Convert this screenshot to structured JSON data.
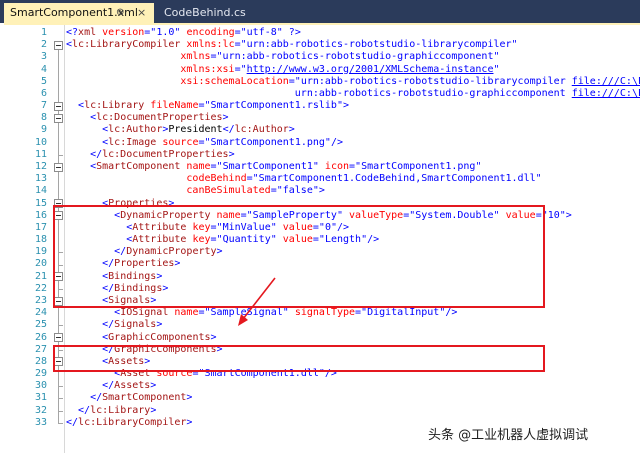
{
  "tabs": [
    {
      "label": "SmartComponent1.xml",
      "pin_icon": "pin-icon",
      "pin_glyph": "⊕",
      "close_icon": "close-icon",
      "close_glyph": "×",
      "active": true
    },
    {
      "label": "CodeBehind.cs",
      "active": false
    }
  ],
  "code_lines": [
    {
      "n": "1",
      "t": [
        [
          "b",
          "<?"
        ],
        [
          "e",
          "xml"
        ],
        [
          "a",
          " version"
        ],
        [
          "b",
          "=\""
        ],
        [
          "v",
          "1.0"
        ],
        [
          "b",
          "\""
        ],
        [
          "a",
          " encoding"
        ],
        [
          "b",
          "=\""
        ],
        [
          "v",
          "utf-8"
        ],
        [
          "b",
          "\" ?>"
        ]
      ]
    },
    {
      "n": "2",
      "t": [
        [
          "b",
          "<"
        ],
        [
          "e",
          "lc:LibraryCompiler"
        ],
        [
          "a",
          " xmlns:lc"
        ],
        [
          "b",
          "=\""
        ],
        [
          "v",
          "urn:abb-robotics-robotstudio-librarycompiler"
        ],
        [
          "b",
          "\""
        ]
      ]
    },
    {
      "n": "3",
      "t": [
        [
          "a",
          "                   xmlns"
        ],
        [
          "b",
          "=\""
        ],
        [
          "v",
          "urn:abb-robotics-robotstudio-graphiccomponent"
        ],
        [
          "b",
          "\""
        ]
      ]
    },
    {
      "n": "4",
      "t": [
        [
          "a",
          "                   xmlns:xsi"
        ],
        [
          "b",
          "=\""
        ],
        [
          "u",
          "http://www.w3.org/2001/XMLSchema-instance"
        ],
        [
          "b",
          "\""
        ]
      ]
    },
    {
      "n": "5",
      "t": [
        [
          "a",
          "                   xsi:schemaLocation"
        ],
        [
          "b",
          "=\""
        ],
        [
          "v",
          "urn:abb-robotics-robotstudio-librarycompiler "
        ],
        [
          "u",
          "file:///C:\\Progra"
        ]
      ]
    },
    {
      "n": "6",
      "t": [
        [
          "v",
          "                                      urn:abb-robotics-robotstudio-graphiccomponent "
        ],
        [
          "u",
          "file:///C:\\Progra"
        ]
      ]
    },
    {
      "n": "7",
      "t": [
        [
          "b",
          "  <"
        ],
        [
          "e",
          "lc:Library"
        ],
        [
          "a",
          " fileName"
        ],
        [
          "b",
          "=\""
        ],
        [
          "v",
          "SmartComponent1.rslib"
        ],
        [
          "b",
          "\">"
        ]
      ]
    },
    {
      "n": "8",
      "t": [
        [
          "b",
          "    <"
        ],
        [
          "e",
          "lc:DocumentProperties"
        ],
        [
          "b",
          ">"
        ]
      ]
    },
    {
      "n": "9",
      "t": [
        [
          "b",
          "      <"
        ],
        [
          "e",
          "lc:Author"
        ],
        [
          "b",
          ">"
        ],
        [
          "",
          "President"
        ],
        [
          "b",
          "</"
        ],
        [
          "e",
          "lc:Author"
        ],
        [
          "b",
          ">"
        ]
      ]
    },
    {
      "n": "10",
      "t": [
        [
          "b",
          "      <"
        ],
        [
          "e",
          "lc:Image"
        ],
        [
          "a",
          " source"
        ],
        [
          "b",
          "=\""
        ],
        [
          "v",
          "SmartComponent1.png"
        ],
        [
          "b",
          "\"/>"
        ]
      ]
    },
    {
      "n": "11",
      "t": [
        [
          "b",
          "    </"
        ],
        [
          "e",
          "lc:DocumentProperties"
        ],
        [
          "b",
          ">"
        ]
      ]
    },
    {
      "n": "12",
      "t": [
        [
          "b",
          "    <"
        ],
        [
          "e",
          "SmartComponent"
        ],
        [
          "a",
          " name"
        ],
        [
          "b",
          "=\""
        ],
        [
          "v",
          "SmartComponent1"
        ],
        [
          "b",
          "\""
        ],
        [
          "a",
          " icon"
        ],
        [
          "b",
          "=\""
        ],
        [
          "v",
          "SmartComponent1.png"
        ],
        [
          "b",
          "\""
        ]
      ]
    },
    {
      "n": "13",
      "t": [
        [
          "a",
          "                    codeBehind"
        ],
        [
          "b",
          "=\""
        ],
        [
          "v",
          "SmartComponent1.CodeBehind,SmartComponent1.dll"
        ],
        [
          "b",
          "\""
        ]
      ]
    },
    {
      "n": "14",
      "t": [
        [
          "a",
          "                    canBeSimulated"
        ],
        [
          "b",
          "=\""
        ],
        [
          "v",
          "false"
        ],
        [
          "b",
          "\">"
        ]
      ]
    },
    {
      "n": "15",
      "t": [
        [
          "b",
          "      <"
        ],
        [
          "e",
          "Properties"
        ],
        [
          "b",
          ">"
        ]
      ]
    },
    {
      "n": "16",
      "t": [
        [
          "b",
          "        <"
        ],
        [
          "e",
          "DynamicProperty"
        ],
        [
          "a",
          " name"
        ],
        [
          "b",
          "=\""
        ],
        [
          "v",
          "SampleProperty"
        ],
        [
          "b",
          "\""
        ],
        [
          "a",
          " valueType"
        ],
        [
          "b",
          "=\""
        ],
        [
          "v",
          "System.Double"
        ],
        [
          "b",
          "\""
        ],
        [
          "a",
          " value"
        ],
        [
          "b",
          "=\""
        ],
        [
          "v",
          "10"
        ],
        [
          "b",
          "\">"
        ]
      ]
    },
    {
      "n": "17",
      "t": [
        [
          "b",
          "          <"
        ],
        [
          "e",
          "Attribute"
        ],
        [
          "a",
          " key"
        ],
        [
          "b",
          "=\""
        ],
        [
          "v",
          "MinValue"
        ],
        [
          "b",
          "\""
        ],
        [
          "a",
          " value"
        ],
        [
          "b",
          "=\""
        ],
        [
          "v",
          "0"
        ],
        [
          "b",
          "\"/>"
        ]
      ]
    },
    {
      "n": "18",
      "t": [
        [
          "b",
          "          <"
        ],
        [
          "e",
          "Attribute"
        ],
        [
          "a",
          " key"
        ],
        [
          "b",
          "=\""
        ],
        [
          "v",
          "Quantity"
        ],
        [
          "b",
          "\""
        ],
        [
          "a",
          " value"
        ],
        [
          "b",
          "=\""
        ],
        [
          "v",
          "Length"
        ],
        [
          "b",
          "\"/>"
        ]
      ]
    },
    {
      "n": "19",
      "t": [
        [
          "b",
          "        </"
        ],
        [
          "e",
          "DynamicProperty"
        ],
        [
          "b",
          ">"
        ]
      ]
    },
    {
      "n": "20",
      "t": [
        [
          "b",
          "      </"
        ],
        [
          "e",
          "Properties"
        ],
        [
          "b",
          ">"
        ]
      ]
    },
    {
      "n": "21",
      "t": [
        [
          "b",
          "      <"
        ],
        [
          "e",
          "Bindings"
        ],
        [
          "b",
          ">"
        ]
      ]
    },
    {
      "n": "22",
      "t": [
        [
          "b",
          "      </"
        ],
        [
          "e",
          "Bindings"
        ],
        [
          "b",
          ">"
        ]
      ]
    },
    {
      "n": "23",
      "t": [
        [
          "b",
          "      <"
        ],
        [
          "e",
          "Signals"
        ],
        [
          "b",
          ">"
        ]
      ]
    },
    {
      "n": "24",
      "t": [
        [
          "b",
          "        <"
        ],
        [
          "e",
          "IOSignal"
        ],
        [
          "a",
          " name"
        ],
        [
          "b",
          "=\""
        ],
        [
          "v",
          "SampleSignal"
        ],
        [
          "b",
          "\""
        ],
        [
          "a",
          " signalType"
        ],
        [
          "b",
          "=\""
        ],
        [
          "v",
          "DigitalInput"
        ],
        [
          "b",
          "\"/>"
        ]
      ]
    },
    {
      "n": "25",
      "t": [
        [
          "b",
          "      </"
        ],
        [
          "e",
          "Signals"
        ],
        [
          "b",
          ">"
        ]
      ]
    },
    {
      "n": "26",
      "t": [
        [
          "b",
          "      <"
        ],
        [
          "e",
          "GraphicComponents"
        ],
        [
          "b",
          ">"
        ]
      ]
    },
    {
      "n": "27",
      "t": [
        [
          "b",
          "      </"
        ],
        [
          "e",
          "GraphicComponents"
        ],
        [
          "b",
          ">"
        ]
      ]
    },
    {
      "n": "28",
      "t": [
        [
          "b",
          "      <"
        ],
        [
          "e",
          "Assets"
        ],
        [
          "b",
          ">"
        ]
      ]
    },
    {
      "n": "29",
      "t": [
        [
          "b",
          "        <"
        ],
        [
          "e",
          "Asset"
        ],
        [
          "a",
          " source"
        ],
        [
          "b",
          "=\""
        ],
        [
          "v",
          "SmartComponent1.dll"
        ],
        [
          "b",
          "\"/>"
        ]
      ]
    },
    {
      "n": "30",
      "t": [
        [
          "b",
          "      </"
        ],
        [
          "e",
          "Assets"
        ],
        [
          "b",
          ">"
        ]
      ]
    },
    {
      "n": "31",
      "t": [
        [
          "b",
          "    </"
        ],
        [
          "e",
          "SmartComponent"
        ],
        [
          "b",
          ">"
        ]
      ]
    },
    {
      "n": "32",
      "t": [
        [
          "b",
          "  </"
        ],
        [
          "e",
          "lc:Library"
        ],
        [
          "b",
          ">"
        ]
      ]
    },
    {
      "n": "33",
      "t": [
        [
          "b",
          "</"
        ],
        [
          "e",
          "lc:LibraryCompiler"
        ],
        [
          "b",
          ">"
        ]
      ]
    }
  ],
  "watermark": "头条 @工业机器人虚拟调试",
  "colors": {
    "tab_strip": "#2b3b5b",
    "active_tab": "#fff1b8",
    "line_number": "#2b91af",
    "delimiter": "#0000ff",
    "element": "#a31515",
    "attribute": "#ff0000",
    "value": "#0000ff",
    "annotation": "#e4181f"
  }
}
